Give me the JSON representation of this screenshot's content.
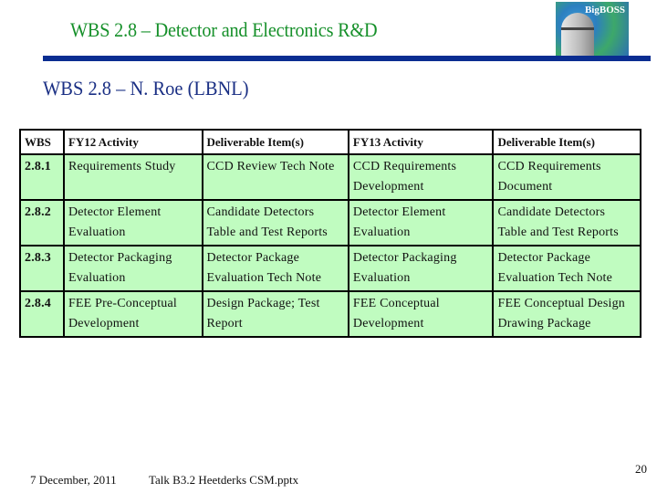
{
  "slide": {
    "title": "WBS 2.8 – Detector and Electronics R&D",
    "subtitle": "WBS 2.8 – N. Roe (LBNL)",
    "logo": {
      "text": "BigBOSS",
      "icon": "bigboss-telescope-logo"
    },
    "colors": {
      "title": "#16902a",
      "subtitle": "#1a2f84",
      "rule": "#0a2d91",
      "cell_fill": "#c0fcc0"
    }
  },
  "table": {
    "headers": [
      "WBS",
      "FY12 Activity",
      "Deliverable Item(s)",
      "FY13 Activity",
      "Deliverable Item(s)"
    ],
    "rows": [
      {
        "wbs": "2.8.1",
        "fy12": "Requirements Study",
        "fy12_deliverable": "CCD Review Tech Note",
        "fy13": "CCD Requirements Development",
        "fy13_deliverable": "CCD Requirements Document"
      },
      {
        "wbs": "2.8.2",
        "fy12": "Detector Element Evaluation",
        "fy12_deliverable": "Candidate Detectors Table and Test Reports",
        "fy13": "Detector Element Evaluation",
        "fy13_deliverable": "Candidate Detectors Table and Test Reports"
      },
      {
        "wbs": "2.8.3",
        "fy12": "Detector Packaging Evaluation",
        "fy12_deliverable": "Detector Package Evaluation Tech Note",
        "fy13": "Detector Packaging Evaluation",
        "fy13_deliverable": "Detector Package Evaluation Tech Note"
      },
      {
        "wbs": "2.8.4",
        "fy12": "FEE Pre-Conceptual Development",
        "fy12_deliverable": "Design Package; Test Report",
        "fy13": "FEE Conceptual Development",
        "fy13_deliverable": "FEE Conceptual Design Drawing Package"
      }
    ]
  },
  "footer": {
    "date": "7 December,  2011",
    "file": "Talk B3.2  Heetderks CSM.pptx",
    "page_number": "20"
  }
}
